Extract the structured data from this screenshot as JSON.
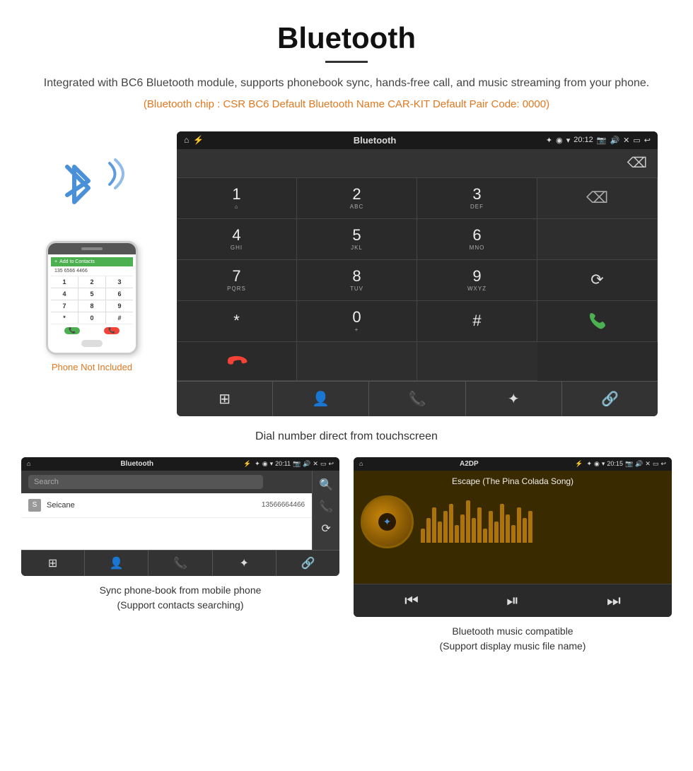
{
  "title": "Bluetooth",
  "description": "Integrated with BC6 Bluetooth module, supports phonebook sync, hands-free call, and music streaming from your phone.",
  "specs": "(Bluetooth chip : CSR BC6    Default Bluetooth Name CAR-KIT    Default Pair Code: 0000)",
  "phone_not_included": "Phone Not Included",
  "dial_caption": "Dial number direct from touchscreen",
  "statusbar": {
    "app_name": "Bluetooth",
    "time": "20:12"
  },
  "keypad": {
    "keys": [
      {
        "main": "1",
        "sub": ""
      },
      {
        "main": "2",
        "sub": "ABC"
      },
      {
        "main": "3",
        "sub": "DEF"
      },
      {
        "main": "",
        "sub": ""
      },
      {
        "main": "4",
        "sub": "GHI"
      },
      {
        "main": "5",
        "sub": "JKL"
      },
      {
        "main": "6",
        "sub": "MNO"
      },
      {
        "main": "",
        "sub": ""
      },
      {
        "main": "7",
        "sub": "PQRS"
      },
      {
        "main": "8",
        "sub": "TUV"
      },
      {
        "main": "9",
        "sub": "WXYZ"
      },
      {
        "main": "⟳",
        "sub": ""
      },
      {
        "main": "*",
        "sub": ""
      },
      {
        "main": "0",
        "sub": "+"
      },
      {
        "main": "#",
        "sub": ""
      },
      {
        "main": "📞green",
        "sub": ""
      },
      {
        "main": "📞red",
        "sub": ""
      }
    ]
  },
  "bottom_nav_icons": [
    "⊞",
    "👤",
    "📞",
    "✦",
    "🔗"
  ],
  "phonebook_screen": {
    "app_name": "Bluetooth",
    "time": "20:11",
    "search_placeholder": "Search",
    "contact": {
      "letter": "S",
      "name": "Seicane",
      "number": "13566664466"
    }
  },
  "music_screen": {
    "app_name": "A2DP",
    "time": "20:15",
    "song_title": "Escape (The Pina Colada Song)",
    "viz_bars": [
      20,
      35,
      50,
      30,
      45,
      55,
      25,
      40,
      60,
      35,
      50,
      20,
      45,
      30,
      55,
      40,
      25,
      50,
      35,
      45
    ]
  },
  "bottom_card_left": {
    "caption_line1": "Sync phone-book from mobile phone",
    "caption_line2": "(Support contacts searching)"
  },
  "bottom_card_right": {
    "caption_line1": "Bluetooth music compatible",
    "caption_line2": "(Support display music file name)"
  }
}
